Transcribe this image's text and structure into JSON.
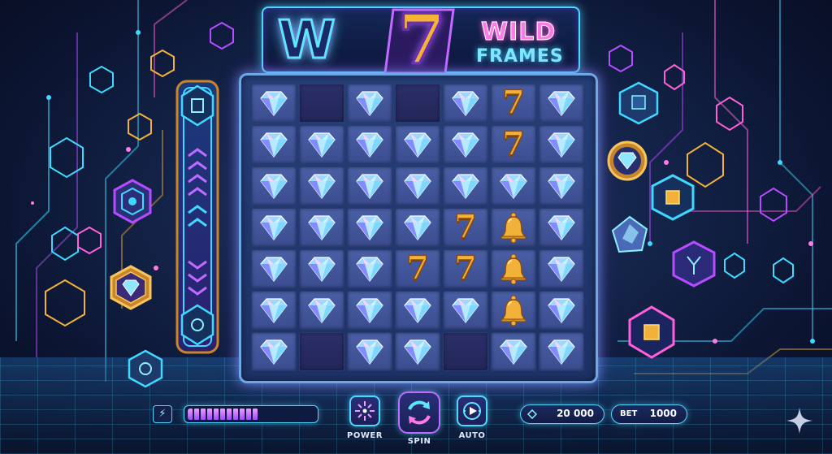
{
  "logo": {
    "w": "W",
    "seven": "7",
    "wild": "WILD",
    "frames": "FRAMES"
  },
  "reels": {
    "columns": 7,
    "rows": 7,
    "grid": [
      [
        "diamond",
        "empty",
        "diamond",
        "empty",
        "diamond",
        "seven",
        "diamond"
      ],
      [
        "diamond",
        "diamond",
        "diamond",
        "diamond",
        "diamond",
        "seven",
        "diamond"
      ],
      [
        "diamond",
        "diamond",
        "diamond",
        "diamond",
        "diamond",
        "diamond",
        "diamond"
      ],
      [
        "diamond",
        "diamond",
        "diamond",
        "diamond",
        "seven",
        "bell",
        "diamond"
      ],
      [
        "diamond",
        "diamond",
        "diamond",
        "seven",
        "seven",
        "bell",
        "diamond"
      ],
      [
        "diamond",
        "diamond",
        "diamond",
        "diamond",
        "diamond",
        "bell",
        "diamond"
      ],
      [
        "diamond",
        "empty",
        "diamond",
        "diamond",
        "empty",
        "diamond",
        "diamond"
      ]
    ],
    "seven_glyph": "7"
  },
  "controls": {
    "bolt_icon": "⚡",
    "power_label": "POWER",
    "spin_label": "SPIN",
    "auto_label": "AUTO",
    "power_level": 0.55
  },
  "balance": {
    "value": "20 000"
  },
  "bet": {
    "label": "BET",
    "value": "1000"
  },
  "colors": {
    "accent_cyan": "#4fd8ff",
    "accent_magenta": "#ff7ae6",
    "accent_purple": "#9c4cff",
    "gold": "#f2b23a"
  },
  "icons": [
    "diamond-icon",
    "seven-icon",
    "bell-icon",
    "chip-icon",
    "lightning-icon",
    "spin-arrows-icon",
    "auto-play-icon",
    "sparkle-icon"
  ]
}
